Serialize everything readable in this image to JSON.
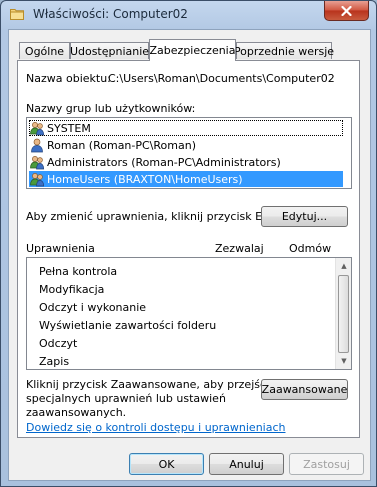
{
  "window": {
    "title": "Właściwości: Computer02",
    "close_icon": "close-icon",
    "folder_icon": "folder-icon"
  },
  "tabs": [
    {
      "label": "Ogólne",
      "active": false
    },
    {
      "label": "Udostępnianie",
      "active": false
    },
    {
      "label": "Zabezpieczenia",
      "active": true
    },
    {
      "label": "Poprzednie wersje",
      "active": false
    }
  ],
  "security": {
    "object_name_label": "Nazwa obiektu:",
    "object_name_value": "C:\\Users\\Roman\\Documents\\Computer02",
    "groups_label": "Nazwy grup lub użytkowników:",
    "principals": [
      {
        "name": "SYSTEM",
        "icon": "group-icon",
        "selected": false
      },
      {
        "name": "Roman (Roman-PC\\Roman)",
        "icon": "user-icon",
        "selected": false
      },
      {
        "name": "Administrators (Roman-PC\\Administrators)",
        "icon": "group-icon",
        "selected": false
      },
      {
        "name": "HomeUsers (BRAXTON\\HomeUsers)",
        "icon": "group-icon",
        "selected": true
      }
    ],
    "change_hint": "Aby zmienić uprawnienia, kliknij przycisk Edytuj.",
    "edit_button": "Edytuj...",
    "permissions_header": "Uprawnienia",
    "allow_header": "Zezwalaj",
    "deny_header": "Odmów",
    "permissions": [
      "Pełna kontrola",
      "Modyfikacja",
      "Odczyt i wykonanie",
      "Wyświetlanie zawartości folderu",
      "Odczyt",
      "Zapis"
    ],
    "advanced_hint_line1": "Kliknij przycisk Zaawansowane, aby przejść do",
    "advanced_hint_line2": "specjalnych uprawnień lub ustawień",
    "advanced_hint_line3": "zaawansowanych.",
    "advanced_button": "Zaawansowane",
    "help_link": "Dowiedz się o kontroli dostępu i uprawnieniach"
  },
  "footer": {
    "ok": "OK",
    "cancel": "Anuluj",
    "apply": "Zastosuj"
  },
  "colors": {
    "selection": "#3399ff",
    "link": "#0066cc"
  }
}
